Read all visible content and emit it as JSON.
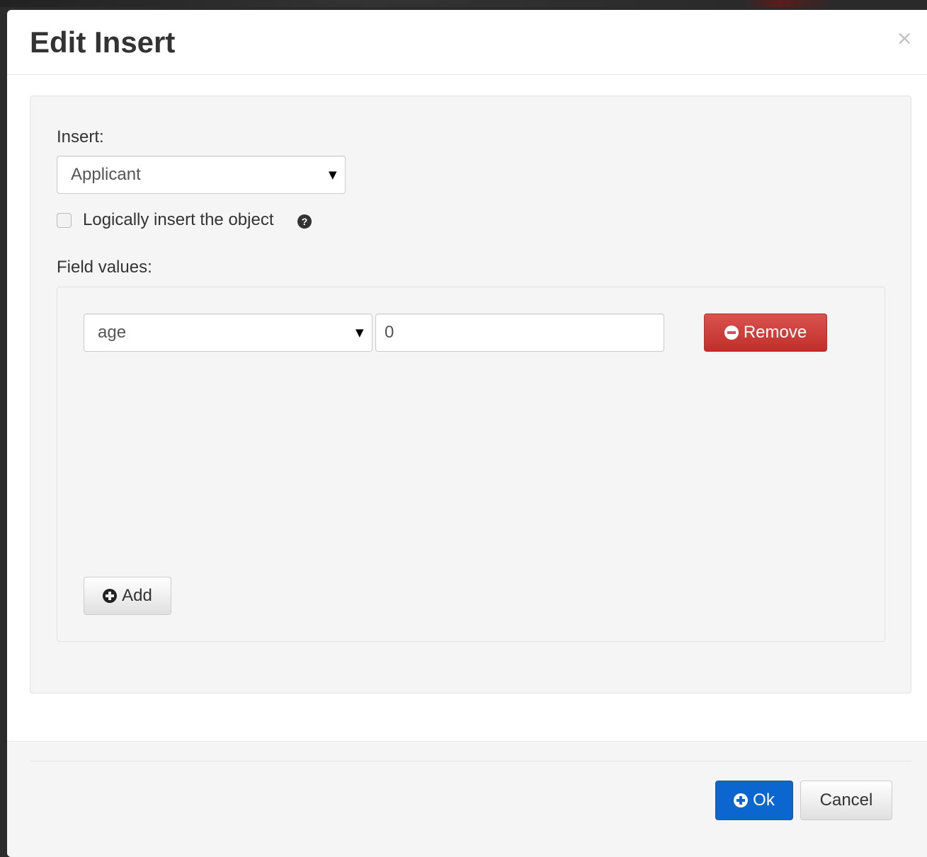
{
  "modal": {
    "title": "Edit Insert",
    "close_label": "×"
  },
  "form": {
    "insert_label": "Insert:",
    "insert_selected": "Applicant",
    "logical_checkbox_label": "Logically insert the object",
    "logical_checked": false,
    "help_icon": "?",
    "field_values_label": "Field values:",
    "field_rows": [
      {
        "field": "age",
        "value": "0",
        "remove_label": "Remove"
      }
    ],
    "add_label": "Add"
  },
  "footer": {
    "ok_label": "Ok",
    "cancel_label": "Cancel"
  },
  "colors": {
    "danger": "#d9534f",
    "primary": "#0b66d0"
  },
  "icons": {
    "close": "close-icon",
    "help": "question-circle-icon",
    "remove": "minus-circle-icon",
    "add": "plus-circle-icon",
    "ok": "plus-circle-icon",
    "select_caret": "caret-down-icon"
  }
}
